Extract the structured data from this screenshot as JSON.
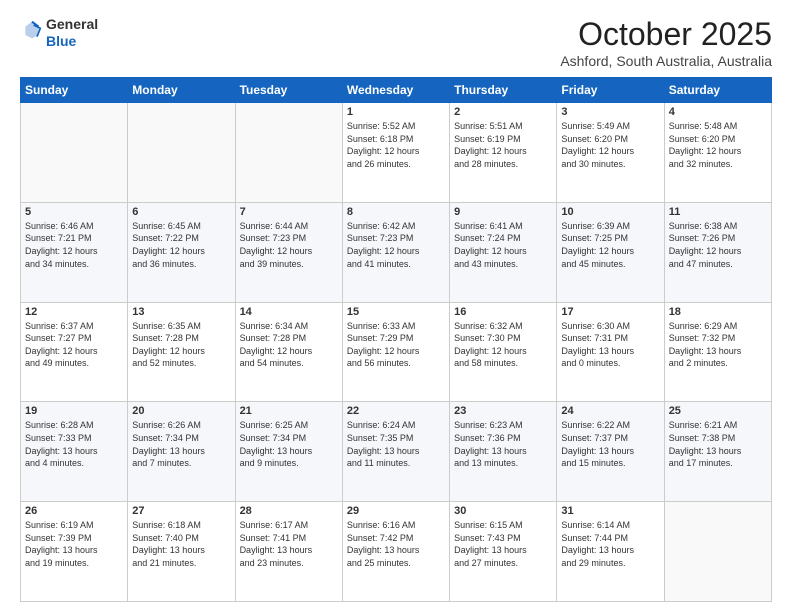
{
  "header": {
    "logo_general": "General",
    "logo_blue": "Blue",
    "month": "October 2025",
    "location": "Ashford, South Australia, Australia"
  },
  "days_of_week": [
    "Sunday",
    "Monday",
    "Tuesday",
    "Wednesday",
    "Thursday",
    "Friday",
    "Saturday"
  ],
  "weeks": [
    [
      {
        "day": "",
        "info": ""
      },
      {
        "day": "",
        "info": ""
      },
      {
        "day": "",
        "info": ""
      },
      {
        "day": "1",
        "info": "Sunrise: 5:52 AM\nSunset: 6:18 PM\nDaylight: 12 hours\nand 26 minutes."
      },
      {
        "day": "2",
        "info": "Sunrise: 5:51 AM\nSunset: 6:19 PM\nDaylight: 12 hours\nand 28 minutes."
      },
      {
        "day": "3",
        "info": "Sunrise: 5:49 AM\nSunset: 6:20 PM\nDaylight: 12 hours\nand 30 minutes."
      },
      {
        "day": "4",
        "info": "Sunrise: 5:48 AM\nSunset: 6:20 PM\nDaylight: 12 hours\nand 32 minutes."
      }
    ],
    [
      {
        "day": "5",
        "info": "Sunrise: 6:46 AM\nSunset: 7:21 PM\nDaylight: 12 hours\nand 34 minutes."
      },
      {
        "day": "6",
        "info": "Sunrise: 6:45 AM\nSunset: 7:22 PM\nDaylight: 12 hours\nand 36 minutes."
      },
      {
        "day": "7",
        "info": "Sunrise: 6:44 AM\nSunset: 7:23 PM\nDaylight: 12 hours\nand 39 minutes."
      },
      {
        "day": "8",
        "info": "Sunrise: 6:42 AM\nSunset: 7:23 PM\nDaylight: 12 hours\nand 41 minutes."
      },
      {
        "day": "9",
        "info": "Sunrise: 6:41 AM\nSunset: 7:24 PM\nDaylight: 12 hours\nand 43 minutes."
      },
      {
        "day": "10",
        "info": "Sunrise: 6:39 AM\nSunset: 7:25 PM\nDaylight: 12 hours\nand 45 minutes."
      },
      {
        "day": "11",
        "info": "Sunrise: 6:38 AM\nSunset: 7:26 PM\nDaylight: 12 hours\nand 47 minutes."
      }
    ],
    [
      {
        "day": "12",
        "info": "Sunrise: 6:37 AM\nSunset: 7:27 PM\nDaylight: 12 hours\nand 49 minutes."
      },
      {
        "day": "13",
        "info": "Sunrise: 6:35 AM\nSunset: 7:28 PM\nDaylight: 12 hours\nand 52 minutes."
      },
      {
        "day": "14",
        "info": "Sunrise: 6:34 AM\nSunset: 7:28 PM\nDaylight: 12 hours\nand 54 minutes."
      },
      {
        "day": "15",
        "info": "Sunrise: 6:33 AM\nSunset: 7:29 PM\nDaylight: 12 hours\nand 56 minutes."
      },
      {
        "day": "16",
        "info": "Sunrise: 6:32 AM\nSunset: 7:30 PM\nDaylight: 12 hours\nand 58 minutes."
      },
      {
        "day": "17",
        "info": "Sunrise: 6:30 AM\nSunset: 7:31 PM\nDaylight: 13 hours\nand 0 minutes."
      },
      {
        "day": "18",
        "info": "Sunrise: 6:29 AM\nSunset: 7:32 PM\nDaylight: 13 hours\nand 2 minutes."
      }
    ],
    [
      {
        "day": "19",
        "info": "Sunrise: 6:28 AM\nSunset: 7:33 PM\nDaylight: 13 hours\nand 4 minutes."
      },
      {
        "day": "20",
        "info": "Sunrise: 6:26 AM\nSunset: 7:34 PM\nDaylight: 13 hours\nand 7 minutes."
      },
      {
        "day": "21",
        "info": "Sunrise: 6:25 AM\nSunset: 7:34 PM\nDaylight: 13 hours\nand 9 minutes."
      },
      {
        "day": "22",
        "info": "Sunrise: 6:24 AM\nSunset: 7:35 PM\nDaylight: 13 hours\nand 11 minutes."
      },
      {
        "day": "23",
        "info": "Sunrise: 6:23 AM\nSunset: 7:36 PM\nDaylight: 13 hours\nand 13 minutes."
      },
      {
        "day": "24",
        "info": "Sunrise: 6:22 AM\nSunset: 7:37 PM\nDaylight: 13 hours\nand 15 minutes."
      },
      {
        "day": "25",
        "info": "Sunrise: 6:21 AM\nSunset: 7:38 PM\nDaylight: 13 hours\nand 17 minutes."
      }
    ],
    [
      {
        "day": "26",
        "info": "Sunrise: 6:19 AM\nSunset: 7:39 PM\nDaylight: 13 hours\nand 19 minutes."
      },
      {
        "day": "27",
        "info": "Sunrise: 6:18 AM\nSunset: 7:40 PM\nDaylight: 13 hours\nand 21 minutes."
      },
      {
        "day": "28",
        "info": "Sunrise: 6:17 AM\nSunset: 7:41 PM\nDaylight: 13 hours\nand 23 minutes."
      },
      {
        "day": "29",
        "info": "Sunrise: 6:16 AM\nSunset: 7:42 PM\nDaylight: 13 hours\nand 25 minutes."
      },
      {
        "day": "30",
        "info": "Sunrise: 6:15 AM\nSunset: 7:43 PM\nDaylight: 13 hours\nand 27 minutes."
      },
      {
        "day": "31",
        "info": "Sunrise: 6:14 AM\nSunset: 7:44 PM\nDaylight: 13 hours\nand 29 minutes."
      },
      {
        "day": "",
        "info": ""
      }
    ]
  ]
}
